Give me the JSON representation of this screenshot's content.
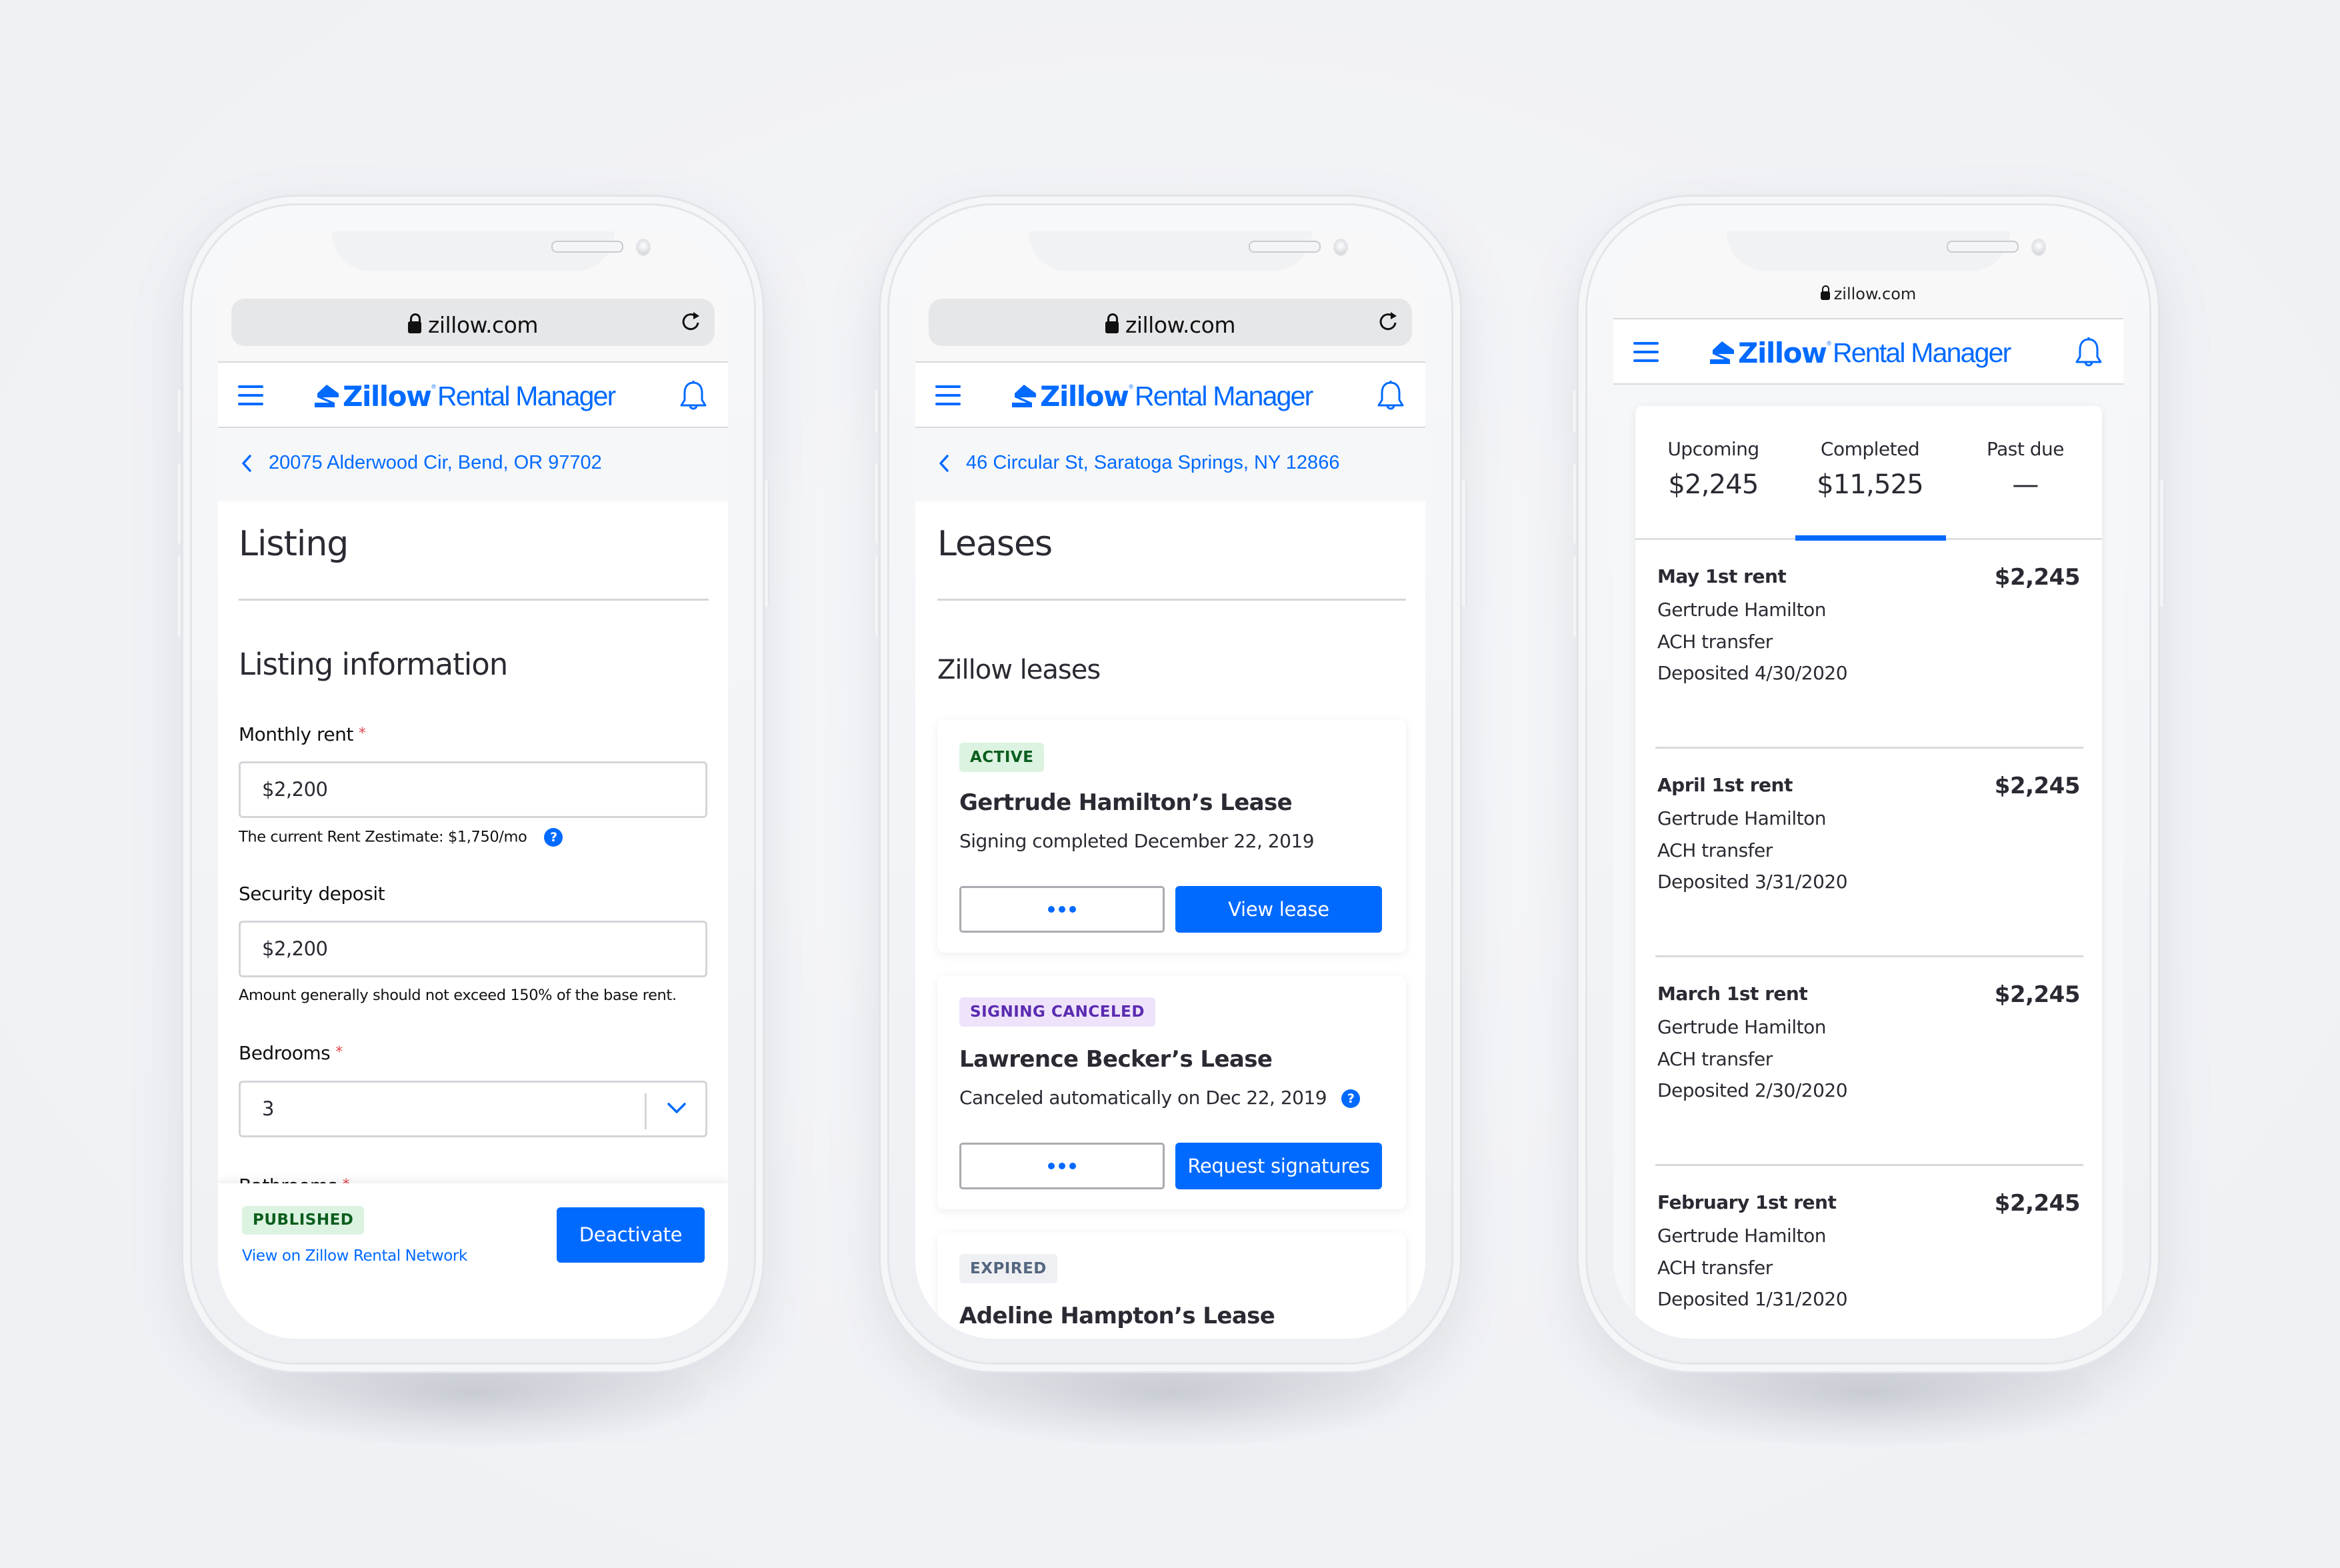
{
  "colors": {
    "brand_blue": "#006AFF",
    "page_background": "#F1F2F6",
    "badge_active_bg": "#DCF3E1",
    "badge_active_text": "#0B5E1E",
    "badge_canceled_bg": "#EFE3FB",
    "badge_canceled_text": "#5A2BB0",
    "badge_expired_bg": "#EFF0F3",
    "badge_expired_text": "#54657F",
    "required_asterisk": "#E5484D"
  },
  "browser": {
    "url": "zillow.com",
    "lock_icon": "lock-icon",
    "reload_icon": "reload-icon"
  },
  "app_header": {
    "brand_bold": "Zillow",
    "brand_reg": "®",
    "brand_light": "Rental Manager",
    "menu_icon": "hamburger-menu-icon",
    "notifications_icon": "bell-icon"
  },
  "phones": [
    {
      "screen": "listing",
      "breadcrumb": "20075 Alderwood Cir, Bend, OR 97702",
      "page_title": "Listing",
      "section_title": "Listing information",
      "fields": {
        "monthly_rent": {
          "label": "Monthly rent",
          "required": "*",
          "value": "$2,200",
          "hint": "The current Rent Zestimate: $1,750/mo",
          "help_icon": "?"
        },
        "security_deposit": {
          "label": "Security deposit",
          "value": "$2,200",
          "hint": "Amount generally should not exceed 150% of the base rent."
        },
        "bedrooms": {
          "label": "Bedrooms",
          "required": "*",
          "value": "3"
        },
        "bathrooms": {
          "label": "Bathrooms",
          "required": "*"
        }
      },
      "footer": {
        "status_badge": "PUBLISHED",
        "link": "View on Zillow Rental Network",
        "primary_button": "Deactivate"
      }
    },
    {
      "screen": "leases",
      "breadcrumb": "46 Circular St, Saratoga Springs, NY 12866",
      "page_title": "Leases",
      "section_title": "Zillow leases",
      "leases": [
        {
          "status": "ACTIVE",
          "title": "Gertrude Hamilton’s Lease",
          "subtitle": "Signing completed December 22, 2019",
          "more_button": "•••",
          "primary_button": "View lease"
        },
        {
          "status": "SIGNING CANCELED",
          "title": "Lawrence Becker’s Lease",
          "subtitle": "Canceled automatically on Dec 22, 2019",
          "help_icon": "?",
          "more_button": "•••",
          "primary_button": "Request signatures"
        },
        {
          "status": "EXPIRED",
          "title": "Adeline Hampton’s Lease"
        }
      ]
    },
    {
      "screen": "payments",
      "summary_tabs": [
        {
          "label": "Upcoming",
          "value": "$2,245"
        },
        {
          "label": "Completed",
          "value": "$11,525",
          "selected": true
        },
        {
          "label": "Past due",
          "value": "—"
        }
      ],
      "payments": [
        {
          "title": "May 1st rent",
          "amount": "$2,245",
          "tenant": "Gertrude Hamilton",
          "method": "ACH transfer",
          "deposited": "Deposited 4/30/2020"
        },
        {
          "title": "April 1st rent",
          "amount": "$2,245",
          "tenant": "Gertrude Hamilton",
          "method": "ACH transfer",
          "deposited": "Deposited 3/31/2020"
        },
        {
          "title": "March 1st rent",
          "amount": "$2,245",
          "tenant": "Gertrude Hamilton",
          "method": "ACH transfer",
          "deposited": "Deposited 2/30/2020"
        },
        {
          "title": "February 1st rent",
          "amount": "$2,245",
          "tenant": "Gertrude Hamilton",
          "method": "ACH transfer",
          "deposited": "Deposited 1/31/2020"
        }
      ]
    }
  ]
}
